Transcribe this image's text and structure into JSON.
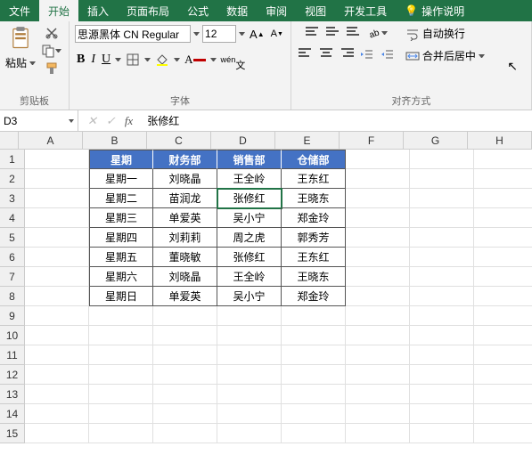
{
  "tabs": {
    "file": "文件",
    "home": "开始",
    "insert": "插入",
    "layout": "页面布局",
    "formula": "公式",
    "data": "数据",
    "review": "审阅",
    "view": "视图",
    "dev": "开发工具",
    "tell": "操作说明"
  },
  "ribbon": {
    "paste": "粘贴",
    "clipboard": "剪贴板",
    "font_name": "思源黑体 CN Regular",
    "font_size": "12",
    "font_group": "字体",
    "wrap": "自动换行",
    "merge": "合并后居中",
    "align_group": "对齐方式"
  },
  "namebox": "D3",
  "formula": "张修红",
  "columns": [
    "A",
    "B",
    "C",
    "D",
    "E",
    "F",
    "G",
    "H"
  ],
  "row_count": 15,
  "table": {
    "header": [
      "星期",
      "财务部",
      "销售部",
      "仓储部"
    ],
    "rows": [
      [
        "星期一",
        "刘晓晶",
        "王全岭",
        "王东红"
      ],
      [
        "星期二",
        "苗润龙",
        "张修红",
        "王晓东"
      ],
      [
        "星期三",
        "单爱英",
        "吴小宁",
        "郑金玲"
      ],
      [
        "星期四",
        "刘莉莉",
        "周之虎",
        "郭秀芳"
      ],
      [
        "星期五",
        "董晓敏",
        "张修红",
        "王东红"
      ],
      [
        "星期六",
        "刘晓晶",
        "王全岭",
        "王晓东"
      ],
      [
        "星期日",
        "单爱英",
        "吴小宁",
        "郑金玲"
      ]
    ]
  },
  "selected_cell": "D3"
}
